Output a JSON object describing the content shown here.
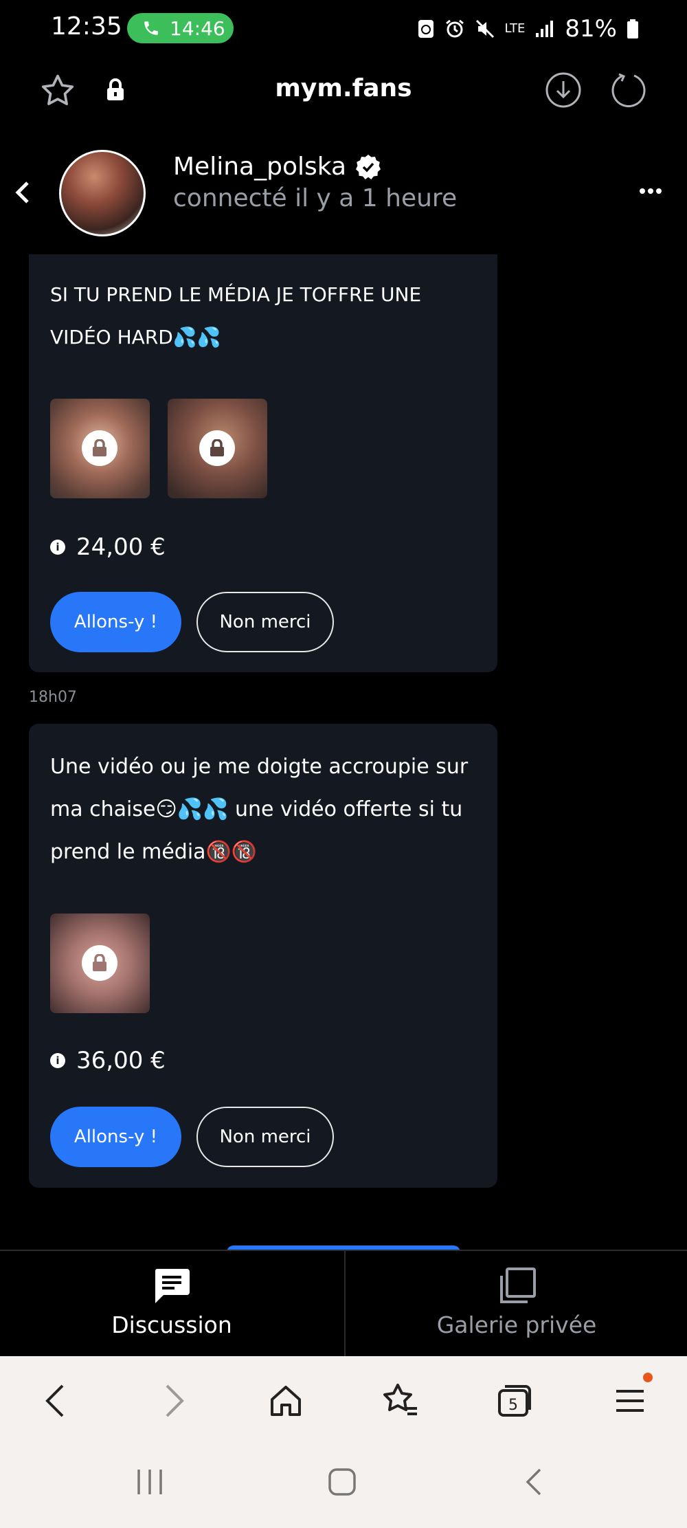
{
  "status_bar": {
    "time": "12:35",
    "call_duration": "14:46",
    "network": "LTE",
    "battery": "81%"
  },
  "browser": {
    "url": "mym.fans"
  },
  "chat": {
    "username": "Melina_polska",
    "presence": "connecté il y a 1 heure",
    "verified": true
  },
  "messages": [
    {
      "text": "SI TU PREND LE MÉDIA JE TOFFRE UNE VIDÉO HARD💦💦",
      "locked_media_count": 2,
      "price": "24,00 €",
      "accept_label": "Allons-y !",
      "decline_label": "Non merci"
    },
    {
      "timestamp": "18h07",
      "text": "Une vidéo ou je me doigte accroupie sur ma chaise😏💦💦 une vidéo offerte si tu prend le média🔞🔞",
      "locked_media_count": 1,
      "price": "36,00 €",
      "accept_label": "Allons-y !",
      "decline_label": "Non merci"
    }
  ],
  "tabs": [
    {
      "label": "Discussion",
      "icon": "chat-icon",
      "active": true
    },
    {
      "label": "Galerie privée",
      "icon": "gallery-icon",
      "active": false
    }
  ],
  "browser_nav": {
    "tab_count": "5"
  },
  "colors": {
    "accent": "#2877f8",
    "bubble": "#141821",
    "call_green": "#3cbf5b",
    "notification": "#e8561a"
  }
}
